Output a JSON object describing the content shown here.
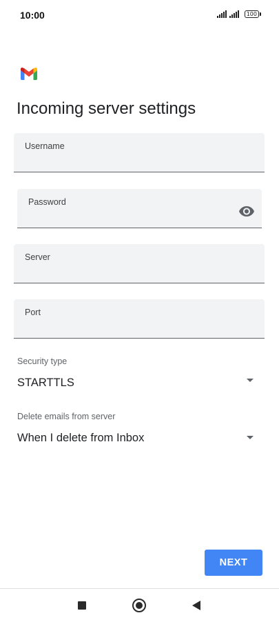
{
  "status_bar": {
    "time": "10:00",
    "battery": "100",
    "icons": [
      "signal-icon",
      "signal-icon",
      "battery-icon"
    ]
  },
  "app": {
    "logo": "gmail-logo",
    "colors": {
      "blue": "#4285F4",
      "red": "#EA4335",
      "yellow": "#FBBC04",
      "green": "#34A853"
    }
  },
  "page": {
    "title": "Incoming server settings"
  },
  "fields": {
    "username": {
      "label": "Username",
      "value": ""
    },
    "password": {
      "label": "Password",
      "value": "",
      "icon": "eye-icon"
    },
    "server": {
      "label": "Server",
      "value": ""
    },
    "port": {
      "label": "Port",
      "value": ""
    }
  },
  "security_type": {
    "label": "Security type",
    "value": "STARTTLS"
  },
  "delete_emails": {
    "label": "Delete emails from server",
    "value": "When I delete from Inbox"
  },
  "actions": {
    "next_label": "NEXT",
    "next_color": "#4285F4"
  },
  "nav_bar": {
    "icons": [
      "recent-apps-icon",
      "home-icon",
      "back-icon"
    ]
  }
}
